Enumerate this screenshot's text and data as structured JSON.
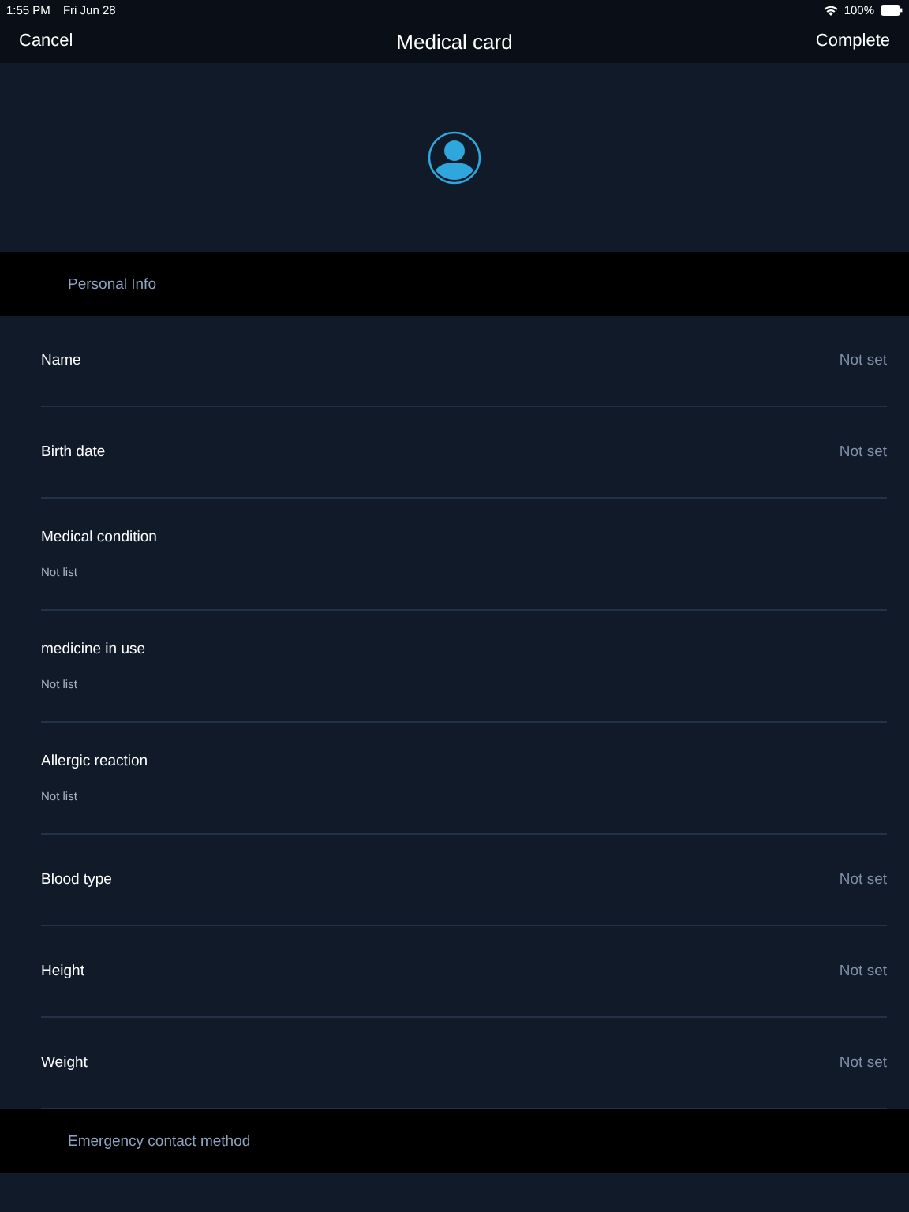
{
  "status_bar": {
    "time": "1:55 PM",
    "date": "Fri Jun 28",
    "battery": "100%"
  },
  "nav": {
    "cancel": "Cancel",
    "title": "Medical card",
    "complete": "Complete"
  },
  "sections": [
    {
      "title": "Personal Info",
      "rows": [
        {
          "kind": "inline",
          "label": "Name",
          "value": "Not set"
        },
        {
          "kind": "inline",
          "label": "Birth date",
          "value": "Not set"
        },
        {
          "kind": "stacked",
          "label": "Medical condition",
          "value": "Not list"
        },
        {
          "kind": "stacked",
          "label": "medicine in use",
          "value": "Not list"
        },
        {
          "kind": "stacked",
          "label": "Allergic reaction",
          "value": "Not list"
        },
        {
          "kind": "inline",
          "label": "Blood type",
          "value": "Not set"
        },
        {
          "kind": "inline",
          "label": "Height",
          "value": "Not set"
        },
        {
          "kind": "inline",
          "label": "Weight",
          "value": "Not set"
        }
      ]
    },
    {
      "title": "Emergency contact method"
    }
  ]
}
